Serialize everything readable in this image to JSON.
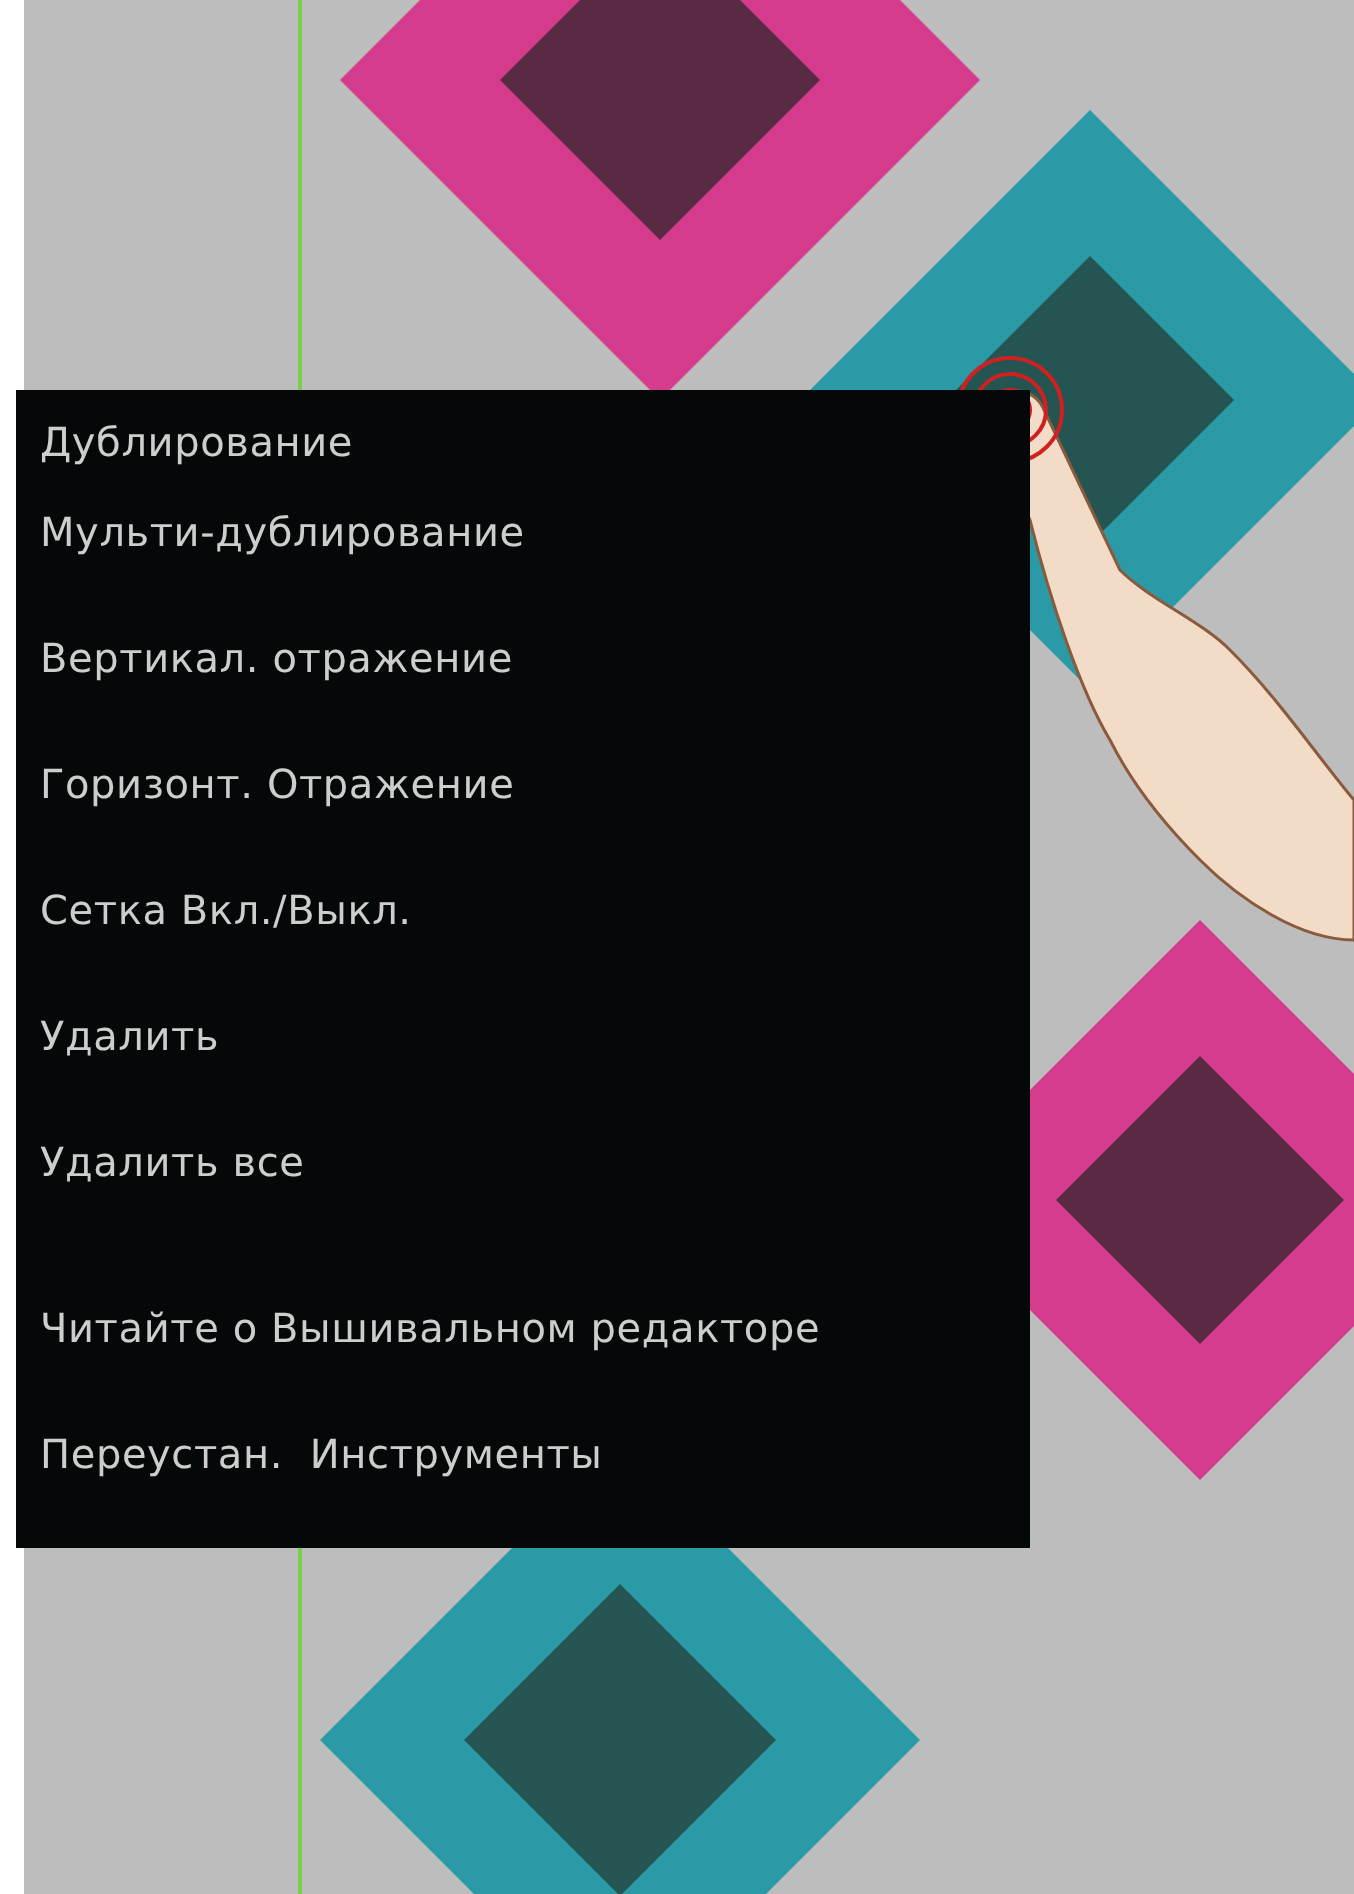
{
  "context_menu": {
    "groups": [
      [
        "Дублирование",
        "Мульти-дублирование",
        "Вертикал. отражение",
        "Горизонт. Отражение",
        "Сетка Вкл./Выкл.",
        "Удалить",
        "Удалить все"
      ],
      [
        "Читайте о Вышивальном редакторе",
        "Переустан.  Инструменты"
      ]
    ]
  }
}
